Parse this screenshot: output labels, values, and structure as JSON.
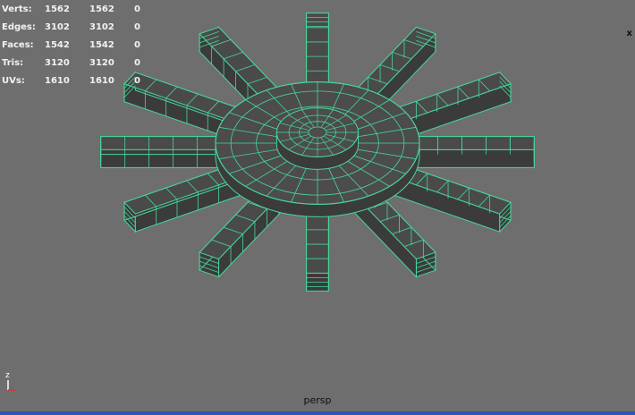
{
  "stats": [
    {
      "label": "Verts:",
      "c1": "1562",
      "c2": "1562",
      "c3": "0"
    },
    {
      "label": "Edges:",
      "c1": "3102",
      "c2": "3102",
      "c3": "0"
    },
    {
      "label": "Faces:",
      "c1": "1542",
      "c2": "1542",
      "c3": "0"
    },
    {
      "label": "Tris:",
      "c1": "3120",
      "c2": "3120",
      "c3": "0"
    },
    {
      "label": "UVs:",
      "c1": "1610",
      "c2": "1610",
      "c3": "0"
    }
  ],
  "viewport": {
    "camera": "persp",
    "close_glyph": "x",
    "axis_label": "z"
  },
  "colors": {
    "background": "#6e6e6e",
    "wire": "#47d69a",
    "mesh_fill": "#3b3b3b",
    "hud_text": "#f2f2f2",
    "accent_bar": "#2b58b4"
  },
  "model": {
    "icon": "gear-wireframe-mesh",
    "teeth": 12
  }
}
